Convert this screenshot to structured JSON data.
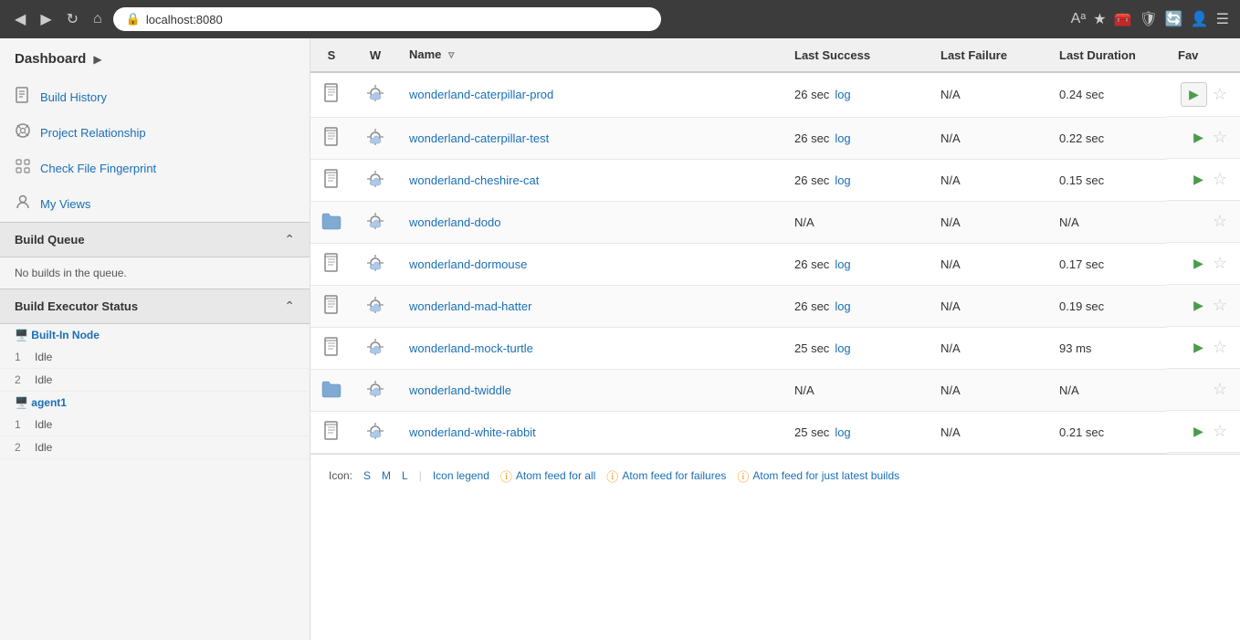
{
  "browser": {
    "url": "localhost:8080",
    "nav_back": "◀",
    "nav_forward": "▶",
    "nav_refresh": "↻",
    "nav_home": "⌂"
  },
  "sidebar": {
    "dashboard_label": "Dashboard",
    "nav_items": [
      {
        "id": "build-history",
        "icon": "📋",
        "label": "Build History"
      },
      {
        "id": "project-relationship",
        "icon": "🔍",
        "label": "Project Relationship"
      },
      {
        "id": "check-file-fingerprint",
        "icon": "🗂️",
        "label": "Check File Fingerprint"
      },
      {
        "id": "my-views",
        "icon": "👤",
        "label": "My Views"
      }
    ],
    "build_queue": {
      "title": "Build Queue",
      "empty_message": "No builds in the queue."
    },
    "build_executor": {
      "title": "Build Executor Status",
      "nodes": [
        {
          "id": "built-in-node",
          "label": "Built-In Node",
          "executors": [
            {
              "num": "1",
              "status": "Idle"
            },
            {
              "num": "2",
              "status": "Idle"
            }
          ]
        },
        {
          "id": "agent1",
          "label": "agent1",
          "executors": [
            {
              "num": "1",
              "status": "Idle"
            },
            {
              "num": "2",
              "status": "Idle"
            }
          ]
        }
      ]
    }
  },
  "table": {
    "columns": {
      "s": "S",
      "w": "W",
      "name": "Name",
      "last_success": "Last Success",
      "last_failure": "Last Failure",
      "last_duration": "Last Duration",
      "fav": "Fav"
    },
    "rows": [
      {
        "id": "wonderland-caterpillar-prod",
        "name": "wonderland-caterpillar-prod",
        "last_success": "26 sec",
        "last_success_log": "log",
        "last_failure": "N/A",
        "last_duration": "0.24 sec",
        "has_play_box": true
      },
      {
        "id": "wonderland-caterpillar-test",
        "name": "wonderland-caterpillar-test",
        "last_success": "26 sec",
        "last_success_log": "log",
        "last_failure": "N/A",
        "last_duration": "0.22 sec",
        "has_play_box": false
      },
      {
        "id": "wonderland-cheshire-cat",
        "name": "wonderland-cheshire-cat",
        "last_success": "26 sec",
        "last_success_log": "log",
        "last_failure": "N/A",
        "last_duration": "0.15 sec",
        "has_play_box": false
      },
      {
        "id": "wonderland-dodo",
        "name": "wonderland-dodo",
        "last_success": "N/A",
        "last_success_log": "",
        "last_failure": "N/A",
        "last_duration": "N/A",
        "has_play_box": false,
        "is_folder": true
      },
      {
        "id": "wonderland-dormouse",
        "name": "wonderland-dormouse",
        "last_success": "26 sec",
        "last_success_log": "log",
        "last_failure": "N/A",
        "last_duration": "0.17 sec",
        "has_play_box": false
      },
      {
        "id": "wonderland-mad-hatter",
        "name": "wonderland-mad-hatter",
        "last_success": "26 sec",
        "last_success_log": "log",
        "last_failure": "N/A",
        "last_duration": "0.19 sec",
        "has_play_box": false
      },
      {
        "id": "wonderland-mock-turtle",
        "name": "wonderland-mock-turtle",
        "last_success": "25 sec",
        "last_success_log": "log",
        "last_failure": "N/A",
        "last_duration": "93 ms",
        "has_play_box": false
      },
      {
        "id": "wonderland-twiddle",
        "name": "wonderland-twiddle",
        "last_success": "N/A",
        "last_success_log": "",
        "last_failure": "N/A",
        "last_duration": "N/A",
        "has_play_box": false,
        "is_folder": true
      },
      {
        "id": "wonderland-white-rabbit",
        "name": "wonderland-white-rabbit",
        "last_success": "25 sec",
        "last_success_log": "log",
        "last_failure": "N/A",
        "last_duration": "0.21 sec",
        "has_play_box": false
      }
    ]
  },
  "footer": {
    "icon_label": "Icon:",
    "size_s": "S",
    "size_m": "M",
    "size_l": "L",
    "icon_legend": "Icon legend",
    "atom_all": "Atom feed for all",
    "atom_failures": "Atom feed for failures",
    "atom_latest": "Atom feed for just latest builds"
  }
}
